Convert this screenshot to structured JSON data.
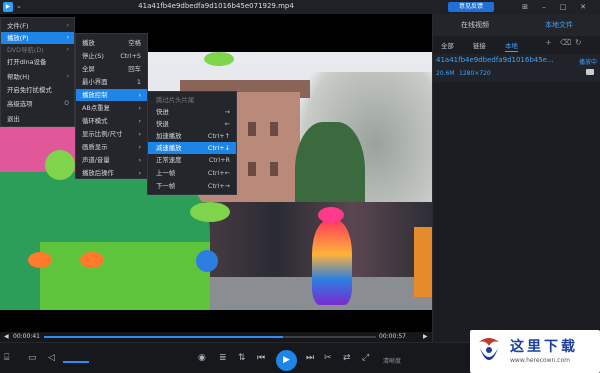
{
  "titlebar": {
    "title": "41a41fb4e9dbedfa9d1016b45e071929.mp4",
    "feedback_label": "意见反馈",
    "window_buttons": [
      "pin-icon",
      "minimize-icon",
      "maximize-icon",
      "close-icon"
    ]
  },
  "menu_main": {
    "items": [
      {
        "label": "文件(F)",
        "arrow": "›"
      },
      {
        "label": "播放(P)",
        "arrow": "›"
      },
      {
        "label": "DVD导航(D)",
        "arrow": "›"
      },
      {
        "label": "打开dlna设备",
        "arrow": ""
      },
      {
        "label": "帮助(H)",
        "arrow": "›"
      },
      {
        "label": "开启免打扰模式",
        "arrow": ""
      },
      {
        "label": "高级选项",
        "arrow": "O"
      },
      {
        "label": "退出",
        "arrow": ""
      }
    ]
  },
  "menu_play": {
    "items": [
      {
        "label": "播放",
        "shortcut": "空格"
      },
      {
        "label": "停止(S)",
        "shortcut": "Ctrl+S"
      },
      {
        "label": "全屏",
        "shortcut": "回车"
      },
      {
        "label": "最小界面",
        "shortcut": "1"
      },
      {
        "label": "播放控制",
        "shortcut": "›"
      },
      {
        "label": "AB点重复",
        "shortcut": "›"
      },
      {
        "label": "循环模式",
        "shortcut": "›"
      },
      {
        "label": "显示比例/尺寸",
        "shortcut": "›"
      },
      {
        "label": "画质显示",
        "shortcut": "›"
      },
      {
        "label": "声道/音量",
        "shortcut": "›"
      },
      {
        "label": "播放后操作",
        "shortcut": "›"
      }
    ]
  },
  "menu_control": {
    "items": [
      {
        "label": "跳过片头片尾",
        "shortcut": ""
      },
      {
        "label": "快进",
        "shortcut": "→"
      },
      {
        "label": "快退",
        "shortcut": "←"
      },
      {
        "label": "加速播放",
        "shortcut": "Ctrl+↑"
      },
      {
        "label": "减速播放",
        "shortcut": "Ctrl+↓"
      },
      {
        "label": "正常速度",
        "shortcut": "Ctrl+R"
      },
      {
        "label": "上一帧",
        "shortcut": "Ctrl+←"
      },
      {
        "label": "下一帧",
        "shortcut": "Ctrl+→"
      }
    ]
  },
  "player": {
    "time_current": "00:00:41",
    "time_total": "00:00:57",
    "progress": 0.72,
    "clear_label": "清晰度"
  },
  "sidebar": {
    "tab_online": "在线视频",
    "tab_local": "本地文件",
    "sub_all": "全部",
    "sub_link": "链接",
    "sub_local": "本地",
    "file_name": "41a41fb4e9dbedfa9d1016b45e...",
    "file_status": "播放中",
    "file_size": "20.6M",
    "file_res": "1280×720"
  },
  "watermark": {
    "text": "这里下载",
    "url": "www.herecown.com"
  },
  "colors": {
    "accent": "#1d84e8",
    "link": "#3fa2ff",
    "bg": "#1b1c20"
  }
}
